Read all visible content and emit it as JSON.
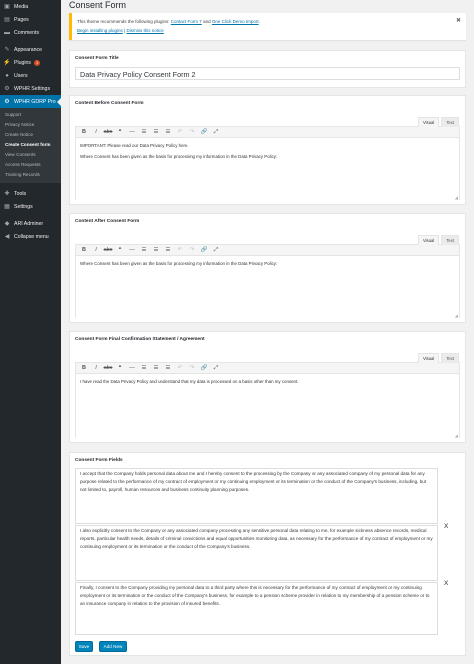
{
  "sidebar": {
    "items": [
      {
        "label": "Media",
        "icon": "media-icon"
      },
      {
        "label": "Pages",
        "icon": "pages-icon"
      },
      {
        "label": "Comments",
        "icon": "comments-icon"
      },
      {
        "label": "Appearance",
        "icon": "appearance-icon"
      },
      {
        "label": "Plugins",
        "icon": "plugins-icon",
        "badge": "1"
      },
      {
        "label": "Users",
        "icon": "users-icon"
      },
      {
        "label": "WPHR Settings",
        "icon": "settings-icon"
      },
      {
        "label": "WPHR GDRP Pro",
        "icon": "gdpr-icon"
      }
    ],
    "submenu": [
      "Support",
      "Privacy Notice",
      "Create Notice",
      "Create Consent form",
      "View Consents",
      "Access Requests",
      "Training Records"
    ],
    "items_after": [
      {
        "label": "Tools",
        "icon": "tools-icon"
      },
      {
        "label": "Settings",
        "icon": "settings-icon"
      },
      {
        "label": "ARI Adminer",
        "icon": "adminer-icon"
      },
      {
        "label": "Collapse menu",
        "icon": "collapse-icon"
      }
    ],
    "active_color": "#0073aa"
  },
  "page": {
    "title": "Consent Form"
  },
  "notice": {
    "text_before": "This theme recommends the following plugins: ",
    "link1": "Contact Form 7",
    "and": " and ",
    "link2": "One Click Demo Import",
    "dot": ".",
    "begin_link": "Begin installing plugins",
    "sep": " | ",
    "dismiss_link": "Dismiss this notice"
  },
  "title_box": {
    "label": "Consent Form Title",
    "value": "Data Privacy Policy Consent Form 2"
  },
  "editor_tabs": {
    "visual": "Visual",
    "text": "Text"
  },
  "toolbar": {
    "bold": "B",
    "italic": "I",
    "strike": "abc",
    "quote": "❝",
    "dash": "—"
  },
  "before_box": {
    "label": "Content Before Consent Form",
    "p1": "IMPORTANT: Please read our Data Privacy Policy here.",
    "p2": "Where Consent has been given as the basis for processing my information in the Data Privacy Policy:"
  },
  "after_box": {
    "label": "Content After Consent Form",
    "p1": "Where Consent has been given as the basis for processing my information in the Data Privacy Policy:"
  },
  "final_box": {
    "label": "Consent Form Final Confirmation Statement / Agreement",
    "p1": "I have read the Data Privacy Policy and understand that my data is processed on a basis other than my consent."
  },
  "fields_box": {
    "label": "Consent Form Fields",
    "fields": [
      "I accept that the Company holds personal data about me and I hereby consent to the processing by the Company or any associated company of my personal data for any purpose related to the performance of my contract of employment or my continuing employment or its termination or the conduct of the Company's business, including, but not limited to, payroll, human resources and business continuity planning purposes.",
      "I also explicitly consent to the Company or any associated company processing any sensitive personal data relating to me, for example sickness absence records, medical reports, particular health needs, details of criminal convictions and equal opportunities monitoring data, as necessary for the performance of my contract of employment or my continuing employment or its termination or the conduct of the Company's business.",
      "Finally, I consent to the Company providing my personal data to a third party where this is necessary for the performance of my contract of employment or my continuing employment or its termination or the conduct of the Company's business, for example to a pension scheme provider in relation to my membership of a pension scheme or to an insurance company in relation to the provision of insured benefits."
    ],
    "remove_label": "X",
    "save_label": "Save",
    "add_label": "Add New"
  }
}
